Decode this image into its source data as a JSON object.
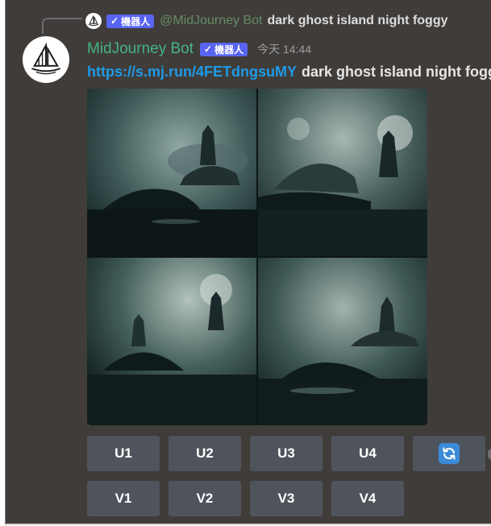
{
  "reply": {
    "bot_tag": "機器人",
    "mention": "@MidJourney Bot",
    "text": "dark ghost island night foggy"
  },
  "message": {
    "author": "MidJourney Bot",
    "bot_tag": "機器人",
    "timestamp": "今天 14:44",
    "link": "https://s.mj.run/4FETdngsuMY",
    "prompt": "dark ghost island night foggy"
  },
  "buttons": {
    "upscale": [
      "U1",
      "U2",
      "U3",
      "U4"
    ],
    "variation": [
      "V1",
      "V2",
      "V3",
      "V4"
    ]
  },
  "colors": {
    "background": "#403c39",
    "author": "#43b581",
    "link": "#1e9ae6",
    "badge": "#5865f2",
    "button": "#4f545c"
  },
  "icons": {
    "avatar": "sailboat-logo-icon",
    "refresh": "refresh-icon",
    "verified": "checkmark-icon"
  }
}
